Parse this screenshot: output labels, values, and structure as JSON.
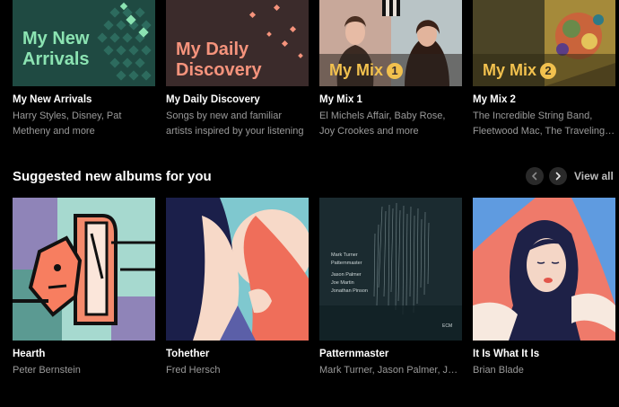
{
  "mixes": [
    {
      "cover_text_line1": "My New",
      "cover_text_line2": "Arrivals",
      "title": "My New Arrivals",
      "subtitle": "Harry Styles, Disney, Pat Metheny and more"
    },
    {
      "cover_text_line1": "My Daily",
      "cover_text_line2": "Discovery",
      "title": "My Daily Discovery",
      "subtitle": "Songs by new and familiar artists inspired by your listening"
    },
    {
      "cover_text": "My Mix",
      "cover_number": "1",
      "title": "My Mix 1",
      "subtitle": "El Michels Affair, Baby Rose, Joy Crookes and more"
    },
    {
      "cover_text": "My Mix",
      "cover_number": "2",
      "title": "My Mix 2",
      "subtitle": "The Incredible String Band, Fleetwood Mac, The Traveling Wilburys and more"
    }
  ],
  "suggested": {
    "heading": "Suggested new albums for you",
    "view_all": "View all",
    "prev_icon": "chevron-left-icon",
    "next_icon": "chevron-right-icon",
    "albums": [
      {
        "title": "Hearth",
        "artist": "Peter Bernstein"
      },
      {
        "title": "Tohether",
        "artist": "Fred Hersch"
      },
      {
        "title": "Patternmaster",
        "artist": "Mark Turner, Jason Palmer, Joe Martin, Jonathan Pinson",
        "cover_lines": [
          "Mark Turner",
          "Patternmaster",
          "Jason Palmer",
          "Joe Martin",
          "Jonathan Pinson"
        ],
        "cover_label": "ECM"
      },
      {
        "title": "It Is What It Is",
        "artist": "Brian Blade"
      }
    ]
  },
  "colors": {
    "background": "#000000",
    "new_arrivals_bg": "#1f4a42",
    "new_arrivals_text": "#8be3b2",
    "daily_bg": "#3a2a2a",
    "daily_text": "#f5937c",
    "mix_text": "#f2c14e"
  }
}
